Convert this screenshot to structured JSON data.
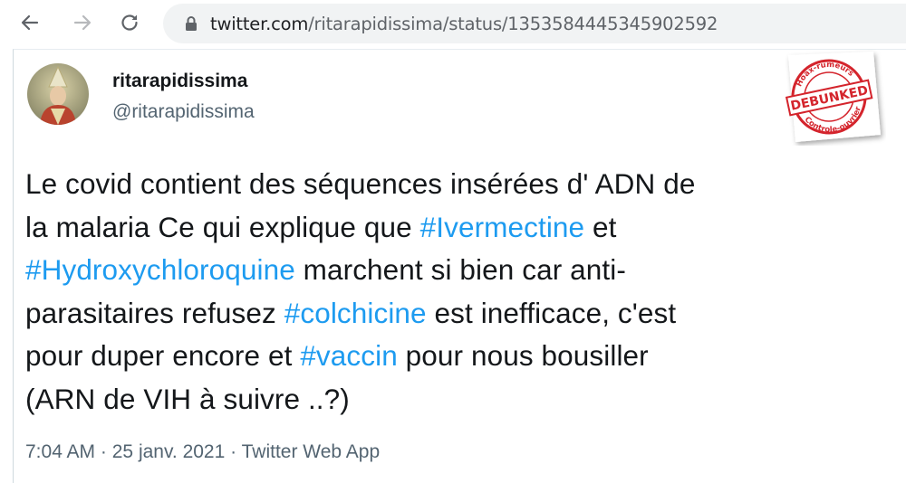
{
  "browser": {
    "url_host": "twitter.com",
    "url_path": "/ritarapidissima/status/1353584445345902592"
  },
  "tweet": {
    "display_name": "ritarapidissima",
    "handle": "@ritarapidissima",
    "stamp": {
      "top_text": "Hoax-rumeurs",
      "center_text": "DEBUNKED",
      "bottom_text": "Controle-ouvrier"
    },
    "text_lines": [
      [
        {
          "t": "Le covid contient des séquences insérées d'  ADN de"
        }
      ],
      [
        {
          "t": "la malaria Ce qui explique que "
        },
        {
          "t": "#Ivermectine",
          "tag": true
        },
        {
          "t": " et"
        }
      ],
      [
        {
          "t": "#Hydroxychloroquine",
          "tag": true
        },
        {
          "t": " marchent si bien car anti-"
        }
      ],
      [
        {
          "t": "parasitaires refusez "
        },
        {
          "t": "#colchicine",
          "tag": true
        },
        {
          "t": " est inefficace, c'est"
        }
      ],
      [
        {
          "t": "pour duper encore et   "
        },
        {
          "t": "#vaccin",
          "tag": true
        },
        {
          "t": " pour nous bousiller"
        }
      ],
      [
        {
          "t": "(ARN de VIH à suivre ..?)"
        }
      ]
    ],
    "time": "7:04 AM",
    "separator": "·",
    "date": "25 janv. 2021",
    "source": "Twitter Web App"
  },
  "colors": {
    "hashtag": "#1d9bf0",
    "stamp_red": "#d4242c"
  }
}
